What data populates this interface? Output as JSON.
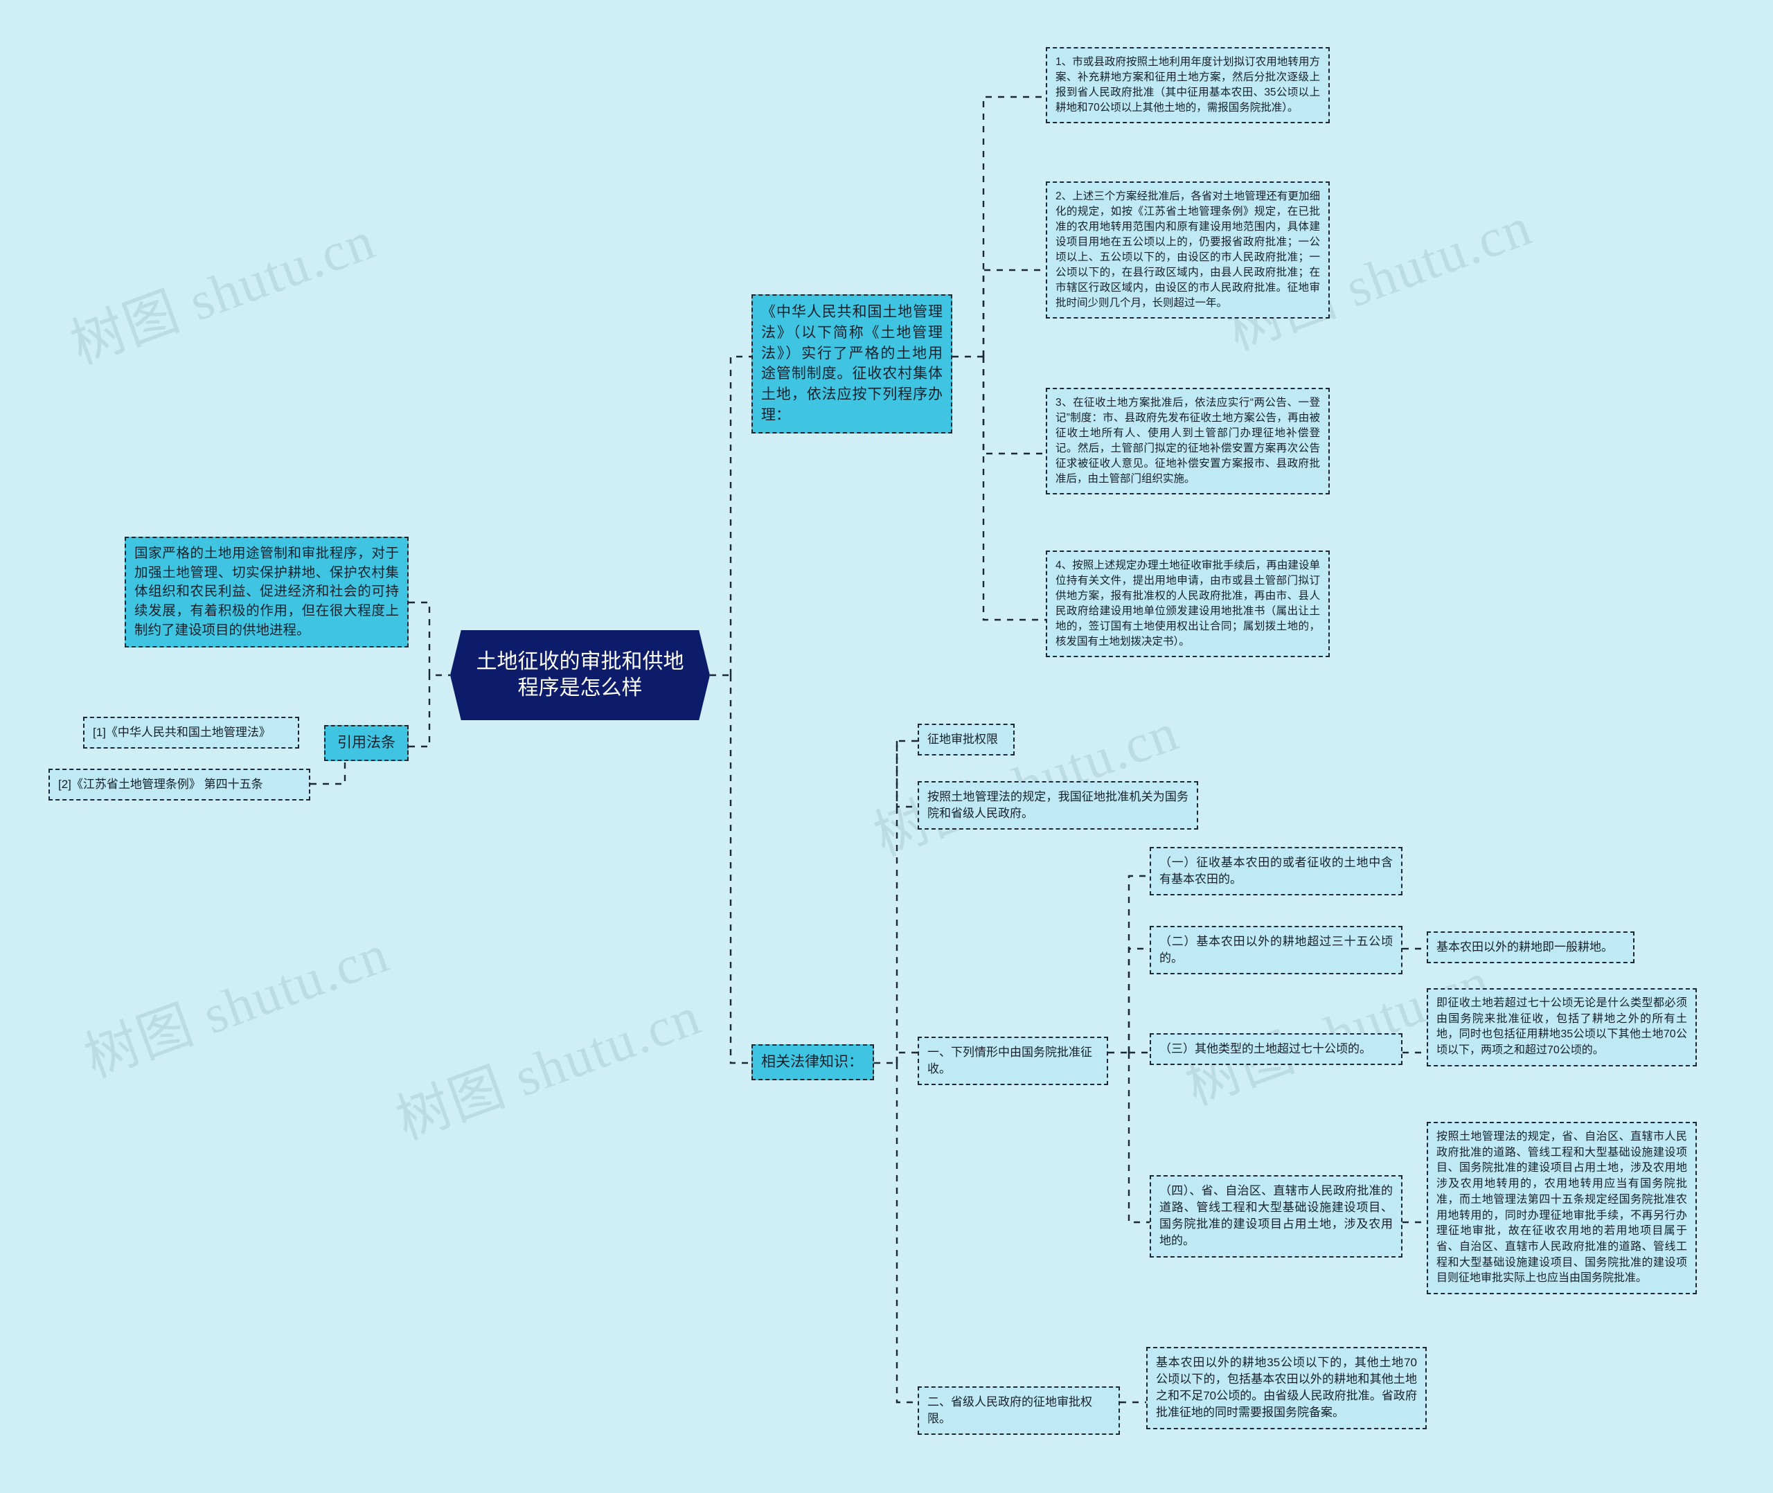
{
  "watermarks": [
    "树图 shutu.cn",
    "树图 shutu.cn",
    "树图 shutu.cn",
    "树图 shutu.cn",
    "树图 shutu.cn",
    "树图 shutu.cn"
  ],
  "colors": {
    "canvas": "#cfeef5",
    "node_fill": "#bfe9f4",
    "accent_fill": "#3fc5e2",
    "central_fill": "#0d1b6b",
    "central_text": "#ffffff",
    "border": "#1b2733"
  },
  "central": {
    "title": "土地征收的审批和供地程序是怎么样"
  },
  "left": {
    "summary": "国家严格的土地用途管制和审批程序，对于加强土地管理、切实保护耕地、保护农村集体组织和农民利益、促进经济和社会的可持续发展，有着积极的作用，但在很大程度上制约了建设项目的供地进程。",
    "citations_label": "引用法条",
    "citations": [
      "[1]《中华人民共和国土地管理法》",
      "[2]《江苏省土地管理条例》 第四十五条"
    ]
  },
  "branch_procedure": {
    "intro": "《中华人民共和国土地管理法》（以下简称《土地管理法》）实行了严格的土地用途管制制度。征收农村集体土地，依法应按下列程序办理：",
    "steps": [
      "1、市或县政府按照土地利用年度计划拟订农用地转用方案、补充耕地方案和征用土地方案，然后分批次逐级上报到省人民政府批准（其中征用基本农田、35公顷以上耕地和70公顷以上其他土地的，需报国务院批准）。",
      "2、上述三个方案经批准后，各省对土地管理还有更加细化的规定，如按《江苏省土地管理条例》规定，在已批准的农用地转用范围内和原有建设用地范围内，具体建设项目用地在五公顷以上的，仍要报省政府批准；一公顷以上、五公顷以下的，由设区的市人民政府批准；一公顷以下的，在县行政区域内，由县人民政府批准；在市辖区行政区域内，由设区的市人民政府批准。征地审批时间少则几个月，长则超过一年。",
      "3、在征收土地方案批准后，依法应实行“两公告、一登记”制度：市、县政府先发布征收土地方案公告，再由被征收土地所有人、使用人到土管部门办理征地补偿登记。然后，土管部门拟定的征地补偿安置方案再次公告征求被征收人意见。征地补偿安置方案报市、县政府批准后，由土管部门组织实施。",
      "4、按照上述规定办理土地征收审批手续后，再由建设单位持有关文件，提出用地申请，由市或县土管部门拟订供地方案，报有批准权的人民政府批准，再由市、县人民政府给建设用地单位颁发建设用地批准书（属出让土地的，签订国有土地使用权出让合同；属划拨土地的，核发国有土地划拨决定书）。"
    ]
  },
  "branch_legal": {
    "label": "相关法律知识：",
    "authority_title": "征地审批权限",
    "authority_desc": "按照土地管理法的规定，我国征地批准机关为国务院和省级人民政府。",
    "section_one": {
      "title": "一、下列情形中由国务院批准征收。",
      "items": [
        {
          "text": "（一）征收基本农田的或者征收的土地中含有基本农田的。",
          "note": null
        },
        {
          "text": "（二）基本农田以外的耕地超过三十五公顷的。",
          "note": "基本农田以外的耕地即一般耕地。"
        },
        {
          "text": "（三）其他类型的土地超过七十公顷的。",
          "note": "即征收土地若超过七十公顷无论是什么类型都必须由国务院来批准征收，包括了耕地之外的所有土地，同时也包括征用耕地35公顷以下其他土地70公顷以下，两项之和超过70公顷的。"
        },
        {
          "text": "（四）、省、自治区、直辖市人民政府批准的道路、管线工程和大型基础设施建设项目、国务院批准的建设项目占用土地，涉及农用地的。",
          "note": "按照土地管理法的规定，省、自治区、直辖市人民政府批准的道路、管线工程和大型基础设施建设项目、国务院批准的建设项目占用土地，涉及农用地涉及农用地转用的，农用地转用应当有国务院批准，而土地管理法第四十五条规定经国务院批准农用地转用的，同时办理征地审批手续，不再另行办理征地审批，故在征收农用地的若用地项目属于省、自治区、直辖市人民政府批准的道路、管线工程和大型基础设施建设项目、国务院批准的建设项目则征地审批实际上也应当由国务院批准。"
        }
      ]
    },
    "section_two": {
      "title": "二、省级人民政府的征地审批权限。",
      "note": "基本农田以外的耕地35公顷以下的，其他土地70公顷以下的，包括基本农田以外的耕地和其他土地之和不足70公顷的。由省级人民政府批准。省政府批准征地的同时需要报国务院备案。"
    }
  }
}
